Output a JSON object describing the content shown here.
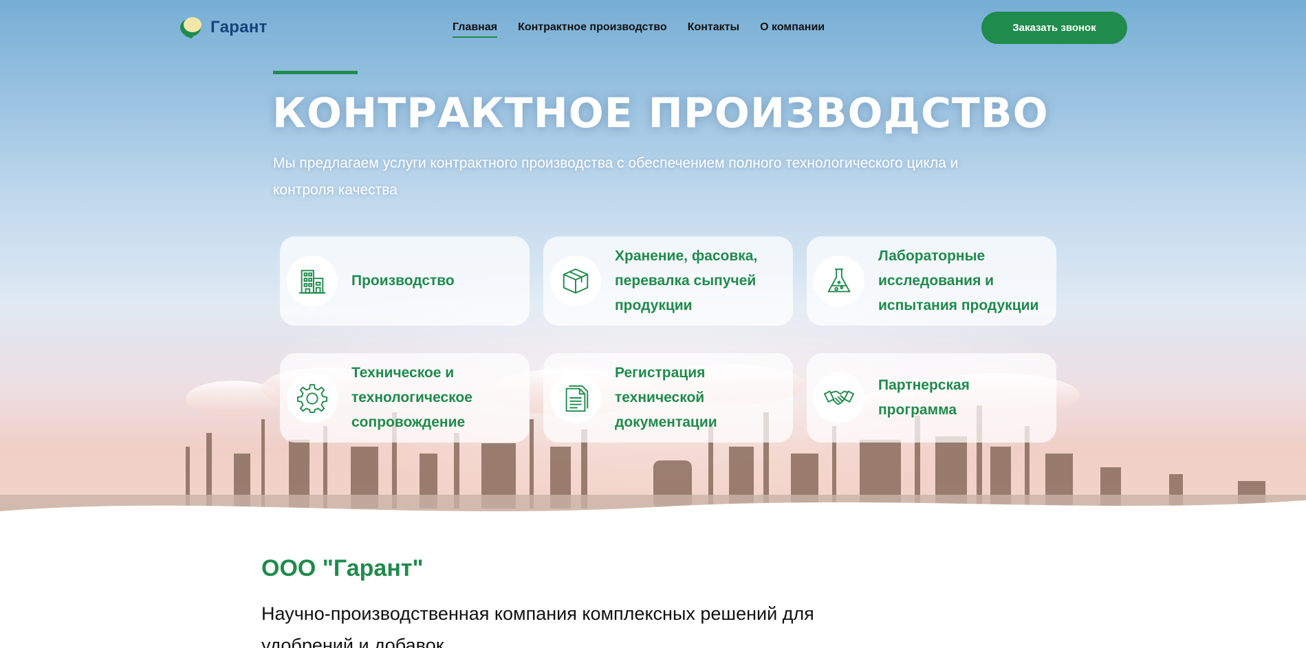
{
  "header": {
    "logo_text": "Гарант",
    "nav": [
      {
        "label": "Главная",
        "active": true
      },
      {
        "label": "Контрактное производство",
        "active": false
      },
      {
        "label": "Контакты",
        "active": false
      },
      {
        "label": "О компании",
        "active": false
      }
    ],
    "cta_label": "Заказать звонок"
  },
  "hero": {
    "title": "КОНТРАКТНОЕ ПРОИЗВОДСТВО",
    "subtitle": "Мы предлагаем услуги контрактного производства с обеспечением полного технологического цикла и контроля качества"
  },
  "services": [
    {
      "label": "Производство",
      "icon": "factory-icon"
    },
    {
      "label": "Хранение, фасовка, перевалка сыпучей продукции",
      "icon": "box-icon"
    },
    {
      "label": "Лабораторные исследования и испытания продукции",
      "icon": "flask-icon"
    },
    {
      "label": "Техническое и технологическое сопровождение",
      "icon": "gear-icon"
    },
    {
      "label": "Регистрация технической документации",
      "icon": "document-icon"
    },
    {
      "label": "Партнерская программа",
      "icon": "handshake-icon"
    }
  ],
  "company": {
    "title": "ООО \"Гарант\"",
    "description": "Научно-производственная компания комплексных решений для удобрений и добавок"
  },
  "colors": {
    "accent": "#1f8b4c",
    "logo_blue": "#12457a",
    "card_bg": "#ffffffb8"
  }
}
